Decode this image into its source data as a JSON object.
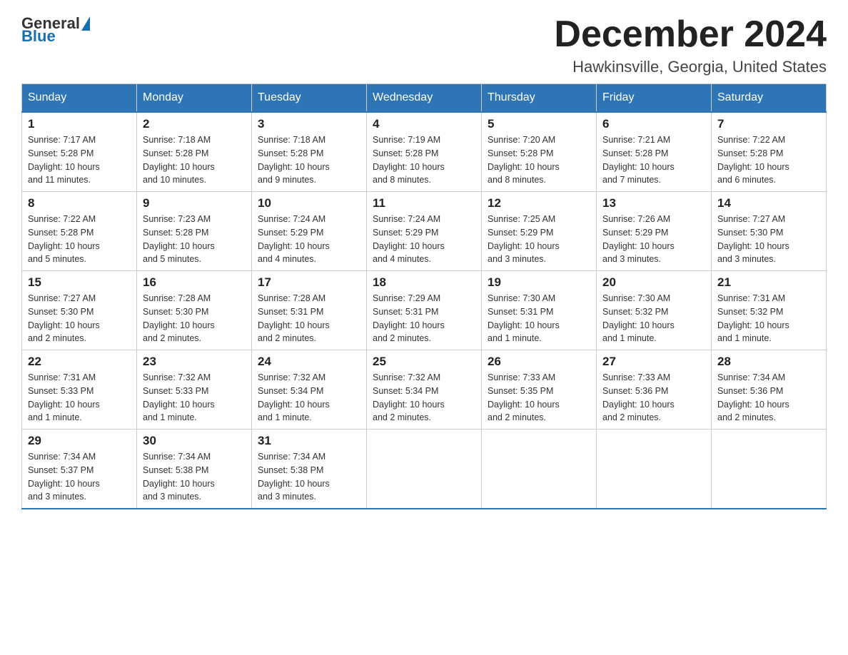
{
  "header": {
    "logo_general": "General",
    "logo_blue": "Blue",
    "month_title": "December 2024",
    "location": "Hawkinsville, Georgia, United States"
  },
  "days_of_week": [
    "Sunday",
    "Monday",
    "Tuesday",
    "Wednesday",
    "Thursday",
    "Friday",
    "Saturday"
  ],
  "weeks": [
    [
      {
        "day": "1",
        "sunrise": "7:17 AM",
        "sunset": "5:28 PM",
        "daylight": "10 hours and 11 minutes."
      },
      {
        "day": "2",
        "sunrise": "7:18 AM",
        "sunset": "5:28 PM",
        "daylight": "10 hours and 10 minutes."
      },
      {
        "day": "3",
        "sunrise": "7:18 AM",
        "sunset": "5:28 PM",
        "daylight": "10 hours and 9 minutes."
      },
      {
        "day": "4",
        "sunrise": "7:19 AM",
        "sunset": "5:28 PM",
        "daylight": "10 hours and 8 minutes."
      },
      {
        "day": "5",
        "sunrise": "7:20 AM",
        "sunset": "5:28 PM",
        "daylight": "10 hours and 8 minutes."
      },
      {
        "day": "6",
        "sunrise": "7:21 AM",
        "sunset": "5:28 PM",
        "daylight": "10 hours and 7 minutes."
      },
      {
        "day": "7",
        "sunrise": "7:22 AM",
        "sunset": "5:28 PM",
        "daylight": "10 hours and 6 minutes."
      }
    ],
    [
      {
        "day": "8",
        "sunrise": "7:22 AM",
        "sunset": "5:28 PM",
        "daylight": "10 hours and 5 minutes."
      },
      {
        "day": "9",
        "sunrise": "7:23 AM",
        "sunset": "5:28 PM",
        "daylight": "10 hours and 5 minutes."
      },
      {
        "day": "10",
        "sunrise": "7:24 AM",
        "sunset": "5:29 PM",
        "daylight": "10 hours and 4 minutes."
      },
      {
        "day": "11",
        "sunrise": "7:24 AM",
        "sunset": "5:29 PM",
        "daylight": "10 hours and 4 minutes."
      },
      {
        "day": "12",
        "sunrise": "7:25 AM",
        "sunset": "5:29 PM",
        "daylight": "10 hours and 3 minutes."
      },
      {
        "day": "13",
        "sunrise": "7:26 AM",
        "sunset": "5:29 PM",
        "daylight": "10 hours and 3 minutes."
      },
      {
        "day": "14",
        "sunrise": "7:27 AM",
        "sunset": "5:30 PM",
        "daylight": "10 hours and 3 minutes."
      }
    ],
    [
      {
        "day": "15",
        "sunrise": "7:27 AM",
        "sunset": "5:30 PM",
        "daylight": "10 hours and 2 minutes."
      },
      {
        "day": "16",
        "sunrise": "7:28 AM",
        "sunset": "5:30 PM",
        "daylight": "10 hours and 2 minutes."
      },
      {
        "day": "17",
        "sunrise": "7:28 AM",
        "sunset": "5:31 PM",
        "daylight": "10 hours and 2 minutes."
      },
      {
        "day": "18",
        "sunrise": "7:29 AM",
        "sunset": "5:31 PM",
        "daylight": "10 hours and 2 minutes."
      },
      {
        "day": "19",
        "sunrise": "7:30 AM",
        "sunset": "5:31 PM",
        "daylight": "10 hours and 1 minute."
      },
      {
        "day": "20",
        "sunrise": "7:30 AM",
        "sunset": "5:32 PM",
        "daylight": "10 hours and 1 minute."
      },
      {
        "day": "21",
        "sunrise": "7:31 AM",
        "sunset": "5:32 PM",
        "daylight": "10 hours and 1 minute."
      }
    ],
    [
      {
        "day": "22",
        "sunrise": "7:31 AM",
        "sunset": "5:33 PM",
        "daylight": "10 hours and 1 minute."
      },
      {
        "day": "23",
        "sunrise": "7:32 AM",
        "sunset": "5:33 PM",
        "daylight": "10 hours and 1 minute."
      },
      {
        "day": "24",
        "sunrise": "7:32 AM",
        "sunset": "5:34 PM",
        "daylight": "10 hours and 1 minute."
      },
      {
        "day": "25",
        "sunrise": "7:32 AM",
        "sunset": "5:34 PM",
        "daylight": "10 hours and 2 minutes."
      },
      {
        "day": "26",
        "sunrise": "7:33 AM",
        "sunset": "5:35 PM",
        "daylight": "10 hours and 2 minutes."
      },
      {
        "day": "27",
        "sunrise": "7:33 AM",
        "sunset": "5:36 PM",
        "daylight": "10 hours and 2 minutes."
      },
      {
        "day": "28",
        "sunrise": "7:34 AM",
        "sunset": "5:36 PM",
        "daylight": "10 hours and 2 minutes."
      }
    ],
    [
      {
        "day": "29",
        "sunrise": "7:34 AM",
        "sunset": "5:37 PM",
        "daylight": "10 hours and 3 minutes."
      },
      {
        "day": "30",
        "sunrise": "7:34 AM",
        "sunset": "5:38 PM",
        "daylight": "10 hours and 3 minutes."
      },
      {
        "day": "31",
        "sunrise": "7:34 AM",
        "sunset": "5:38 PM",
        "daylight": "10 hours and 3 minutes."
      },
      null,
      null,
      null,
      null
    ]
  ],
  "labels": {
    "sunrise": "Sunrise:",
    "sunset": "Sunset:",
    "daylight": "Daylight:"
  }
}
